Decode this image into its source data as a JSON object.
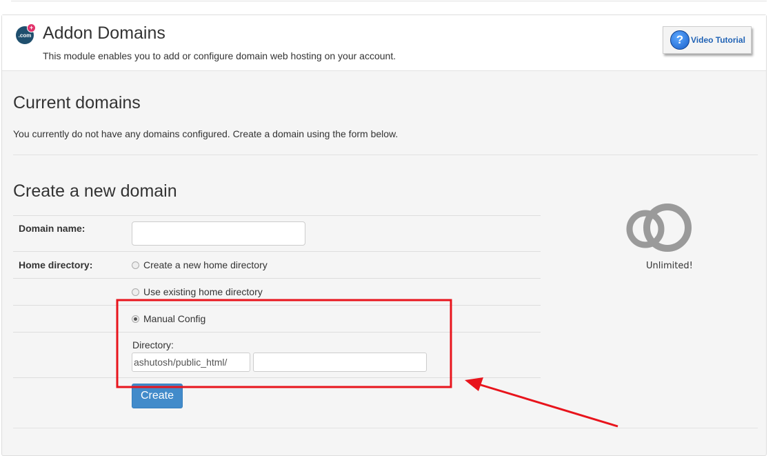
{
  "header": {
    "icon_text": ".com",
    "title": "Addon Domains",
    "description": "This module enables you to add or configure domain web hosting on your account.",
    "video_button_label": "Video Tutorial"
  },
  "current_domains": {
    "heading": "Current domains",
    "message": "You currently do not have any domains configured. Create a domain using the form below."
  },
  "create_form": {
    "heading": "Create a new domain",
    "domain_name_label": "Domain name:",
    "domain_name_value": "",
    "home_directory_label": "Home directory:",
    "options": [
      {
        "label": "Create a new home directory",
        "checked": false
      },
      {
        "label": "Use existing home directory",
        "checked": false
      },
      {
        "label": "Manual Config",
        "checked": true
      }
    ],
    "directory_label": "Directory:",
    "directory_prefix": "ashutosh/public_html/",
    "directory_value": "",
    "create_button": "Create"
  },
  "stats": {
    "limit_text": "Unlimited!",
    "icon": "infinity-icon"
  },
  "colors": {
    "annotation_red": "#e8141c",
    "primary_button": "#428bca"
  }
}
